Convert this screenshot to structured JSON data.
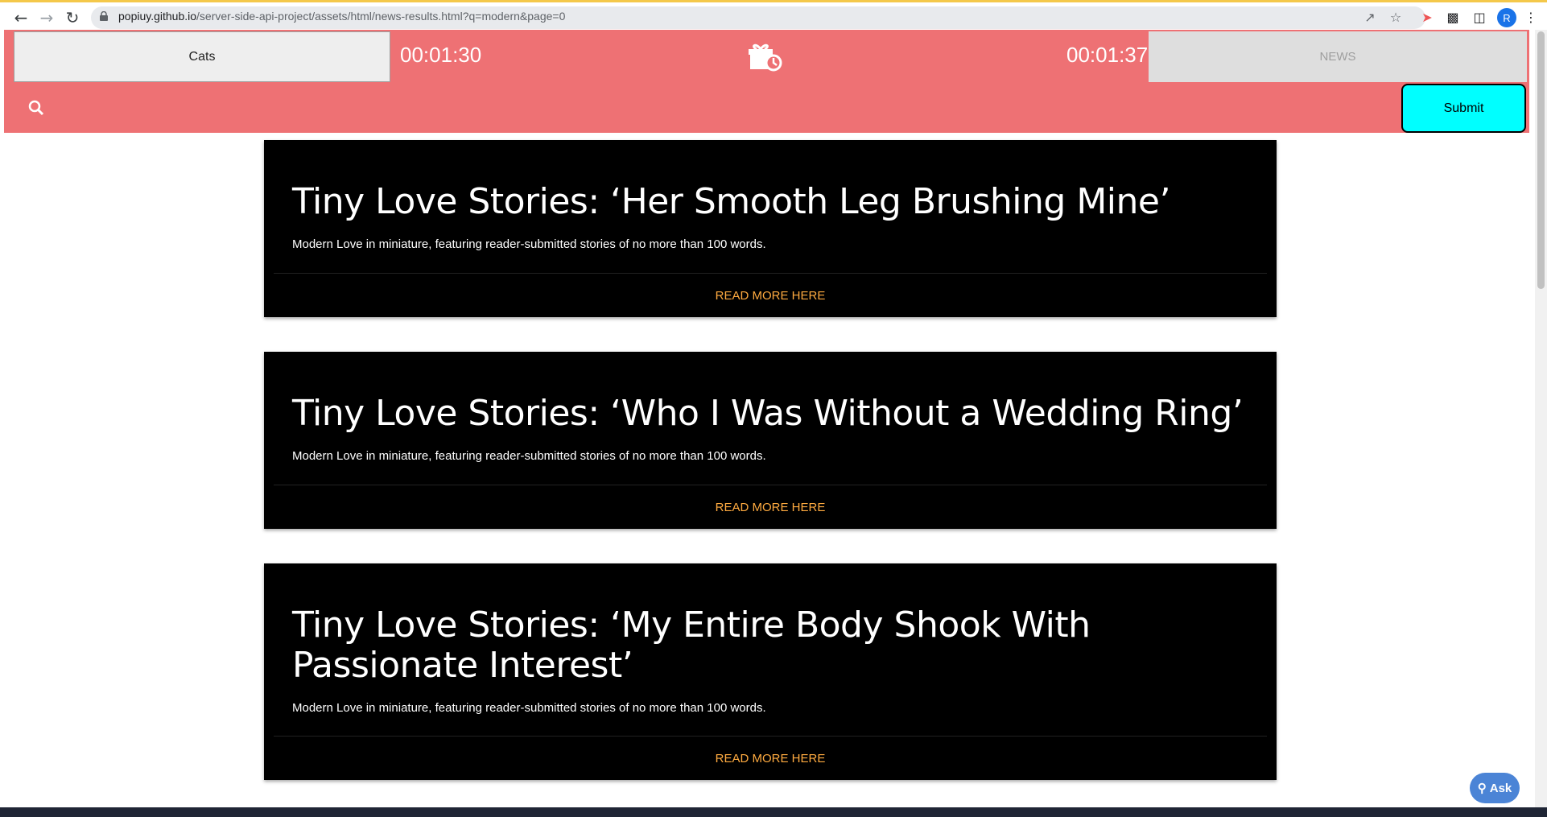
{
  "browser": {
    "url_host": "popiuy.github.io",
    "url_path": "/server-side-api-project/assets/html/news-results.html?q=modern&page=0",
    "profile_initial": "R"
  },
  "header": {
    "cats_tab_label": "Cats",
    "timer_left": "00:01:30",
    "timer_right": "00:01:37",
    "news_tab_label": "NEWS",
    "submit_label": "Submit",
    "accent_color": "#ee7174"
  },
  "articles": [
    {
      "title": "Tiny Love Stories: ‘Her Smooth Leg Brushing Mine’",
      "description": "Modern Love in miniature, featuring reader-submitted stories of no more than 100 words.",
      "link_label": "READ MORE HERE"
    },
    {
      "title": "Tiny Love Stories: ‘Who I Was Without a Wedding Ring’",
      "description": "Modern Love in miniature, featuring reader-submitted stories of no more than 100 words.",
      "link_label": "READ MORE HERE"
    },
    {
      "title": "Tiny Love Stories: ‘My Entire Body Shook With Passionate Interest’",
      "description": "Modern Love in miniature, featuring reader-submitted stories of no more than 100 words.",
      "link_label": "READ MORE HERE"
    }
  ],
  "ask_button_label": "Ask"
}
